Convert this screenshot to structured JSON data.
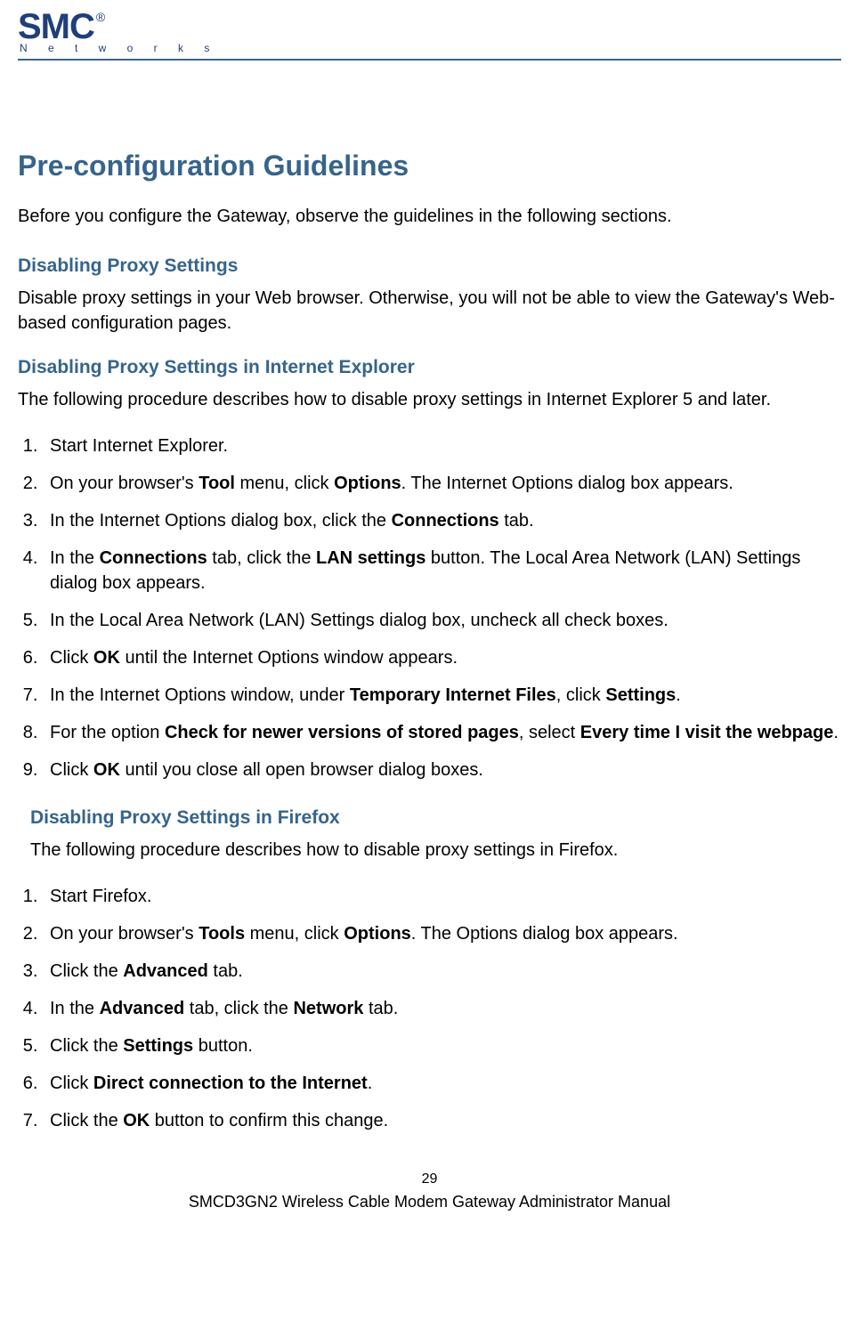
{
  "logo": {
    "main": "SMC",
    "reg": "®",
    "sub": "N e t w o r k s"
  },
  "title": "Pre-configuration Guidelines",
  "intro": "Before you configure the Gateway, observe the guidelines in the following sections.",
  "section1": {
    "heading": "Disabling Proxy Settings",
    "body": "Disable proxy settings in your Web browser. Otherwise, you will not be able to view the Gateway's Web-based configuration pages."
  },
  "section2": {
    "heading": "Disabling Proxy Settings in Internet Explorer",
    "body": "The following procedure describes how to disable proxy settings in Internet Explorer 5 and later.",
    "steps": {
      "s1": "Start Internet Explorer.",
      "s2_a": "On your browser's ",
      "s2_b": "Tool",
      "s2_c": " menu, click ",
      "s2_d": "Options",
      "s2_e": ". The Internet Options dialog box appears.",
      "s3_a": "In the Internet Options dialog box, click the ",
      "s3_b": "Connections",
      "s3_c": " tab.",
      "s4_a": "In the ",
      "s4_b": "Connections",
      "s4_c": " tab, click the ",
      "s4_d": "LAN settings",
      "s4_e": " button. The Local Area Network (LAN) Settings dialog box appears.",
      "s5": "In the Local Area Network (LAN) Settings dialog box, uncheck all check boxes.",
      "s6_a": "Click ",
      "s6_b": "OK",
      "s6_c": " until the Internet Options window appears.",
      "s7_a": "In the Internet Options window, under ",
      "s7_b": "Temporary Internet Files",
      "s7_c": ", click ",
      "s7_d": "Settings",
      "s7_e": ".",
      "s8_a": "For the option ",
      "s8_b": "Check for newer versions of stored pages",
      "s8_c": ", select ",
      "s8_d": "Every time I visit the webpage",
      "s8_e": ".",
      "s9_a": "Click ",
      "s9_b": "OK",
      "s9_c": " until you close all open browser dialog boxes."
    }
  },
  "section3": {
    "heading": "Disabling Proxy Settings in Firefox",
    "body": "The following procedure describes how to disable proxy settings in Firefox.",
    "steps": {
      "s1": "Start Firefox.",
      "s2_a": "On your browser's ",
      "s2_b": "Tools",
      "s2_c": " menu, click ",
      "s2_d": "Options",
      "s2_e": ". The Options dialog box appears.",
      "s3_a": "Click the ",
      "s3_b": "Advanced",
      "s3_c": " tab.",
      "s4_a": "In the ",
      "s4_b": "Advanced",
      "s4_c": " tab, click the ",
      "s4_d": "Network",
      "s4_e": " tab.",
      "s5_a": "Click the ",
      "s5_b": "Settings",
      "s5_c": " button.",
      "s6_a": "Click ",
      "s6_b": "Direct connection to the Internet",
      "s6_c": ".",
      "s7_a": "Click the ",
      "s7_b": "OK",
      "s7_c": " button to confirm this change."
    }
  },
  "footer": {
    "page": "29",
    "manual": "SMCD3GN2 Wireless Cable Modem Gateway Administrator Manual"
  }
}
